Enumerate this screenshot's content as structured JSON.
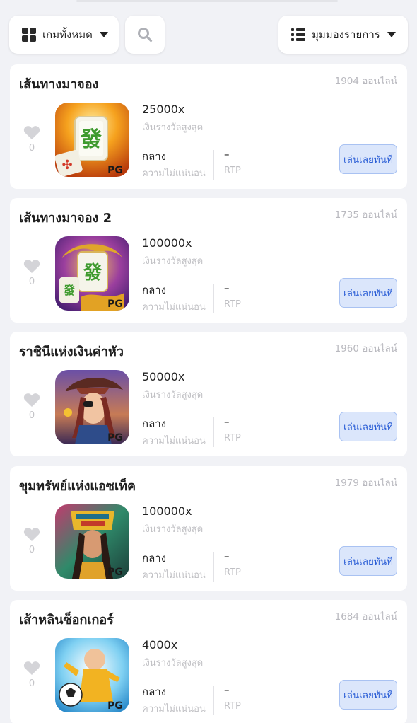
{
  "toolbar": {
    "filter_label": "เกมทั้งหมด",
    "view_label": "มุมมองรายการ"
  },
  "labels": {
    "max_win": "เงินรางวัลสูงสุด",
    "volatility": "ความไม่แน่นอน",
    "rtp": "RTP",
    "play": "เล่นเลยทันที",
    "pg": "PG"
  },
  "games": [
    {
      "title": "เส้นทางมาจอง",
      "online": "1904 ออนไลน์",
      "likes": "0",
      "max_win": "25000x",
      "volatility": "กลาง",
      "rtp": "–"
    },
    {
      "title": "เส้นทางมาจอง 2",
      "online": "1735 ออนไลน์",
      "likes": "0",
      "max_win": "100000x",
      "volatility": "กลาง",
      "rtp": "–"
    },
    {
      "title": "ราชินีแห่งเงินค่าหัว",
      "online": "1960 ออนไลน์",
      "likes": "0",
      "max_win": "50000x",
      "volatility": "กลาง",
      "rtp": "–"
    },
    {
      "title": "ขุมทรัพย์แห่งแอซเท็ค",
      "online": "1979 ออนไลน์",
      "likes": "0",
      "max_win": "100000x",
      "volatility": "กลาง",
      "rtp": "–"
    },
    {
      "title": "เส้าหลินซ็อกเกอร์",
      "online": "1684 ออนไลน์",
      "likes": "0",
      "max_win": "4000x",
      "volatility": "กลาง",
      "rtp": "–"
    }
  ],
  "thumb_icons": [
    "mahjong-ways-thumbnail",
    "mahjong-ways-2-thumbnail",
    "bounty-queen-thumbnail",
    "aztec-treasure-thumbnail",
    "shaolin-soccer-thumbnail"
  ]
}
